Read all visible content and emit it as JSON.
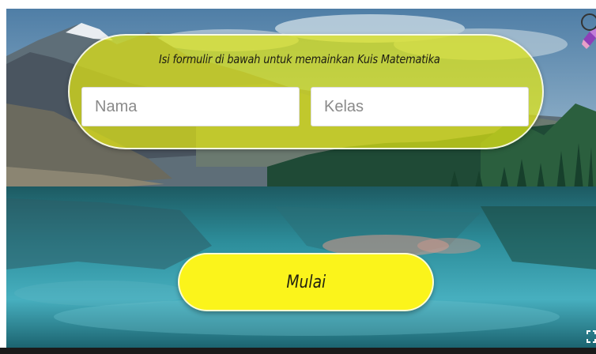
{
  "form": {
    "title": "Isi formulir di bawah untuk memainkan Kuis Matematika",
    "name_field": {
      "placeholder": "Nama",
      "value": ""
    },
    "class_field": {
      "placeholder": "Kelas",
      "value": ""
    }
  },
  "start_button": {
    "label": "Mulai"
  },
  "icons": {
    "corner_logo": "app-logo-icon",
    "fullscreen": "fullscreen-icon"
  },
  "colors": {
    "form_pill": "#e2e614",
    "start_button": "#fbf41b",
    "field_background": "#ffffff"
  }
}
